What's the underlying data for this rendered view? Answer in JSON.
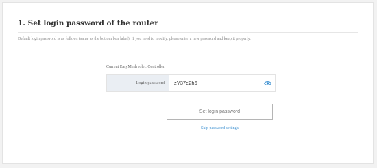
{
  "section": {
    "title": "1. Set login password of the router",
    "description": "Default login password is as follows (same as the bottom box label). If you need to modify, please enter a new password and keep it properly."
  },
  "easymesh": {
    "role_text": "Current EasyMesh role : Controller"
  },
  "password_field": {
    "label": "Login password",
    "value": "zY37d2h6",
    "toggle_icon": "eye-icon",
    "icon_color": "#3a8fd0"
  },
  "actions": {
    "set_button_label": "Set login password",
    "skip_link_label": "Skip password settings"
  },
  "colors": {
    "link": "#3a8fd0",
    "label_bg": "#eaeef3"
  }
}
